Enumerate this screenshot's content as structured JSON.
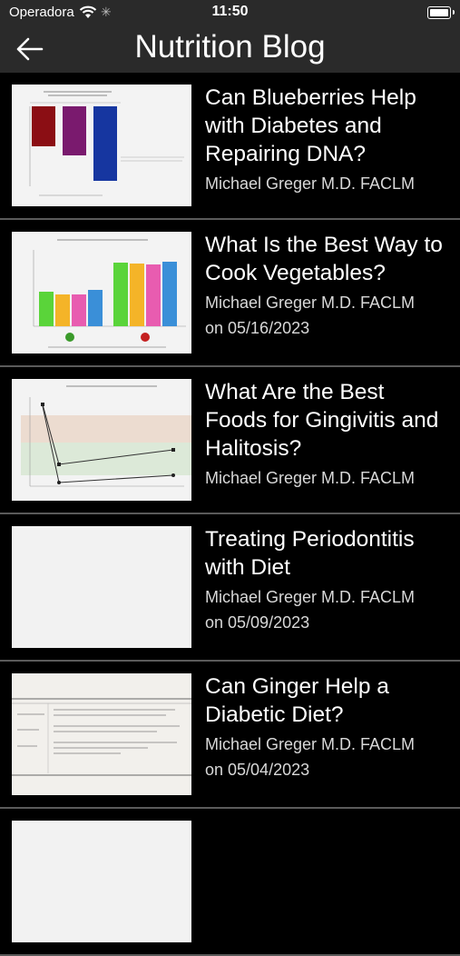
{
  "status_bar": {
    "carrier": "Operadora",
    "time": "11:50"
  },
  "nav": {
    "title": "Nutrition Blog"
  },
  "posts": [
    {
      "title": "Can Blueberries Help with Diabetes and Repairing DNA?",
      "author": "Michael Greger M.D. FACLM",
      "date": ""
    },
    {
      "title": "What Is the Best Way to Cook Vegetables?",
      "author": "Michael Greger M.D. FACLM",
      "date": "on 05/16/2023"
    },
    {
      "title": "What Are the Best Foods for Gingivitis and Halitosis?",
      "author": "Michael Greger M.D. FACLM",
      "date": ""
    },
    {
      "title": "Treating Periodontitis with Diet",
      "author": "Michael Greger M.D. FACLM",
      "date": "on 05/09/2023"
    },
    {
      "title": "Can Ginger Help a Diabetic Diet?",
      "author": "Michael Greger M.D. FACLM",
      "date": "on 05/04/2023"
    }
  ]
}
